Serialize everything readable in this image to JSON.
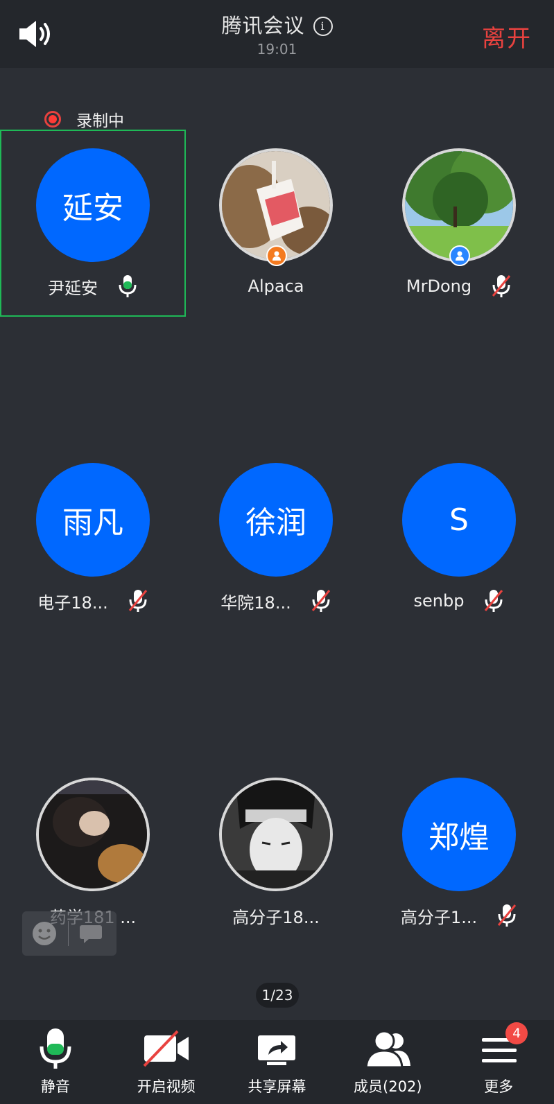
{
  "header": {
    "title": "腾讯会议",
    "time": "19:01",
    "leave_label": "离开"
  },
  "recording": {
    "label": "录制中"
  },
  "participants": [
    {
      "avatar_text": "延安",
      "name": "尹延安",
      "mic": "active"
    },
    {
      "avatar_text": "",
      "name": "Alpaca",
      "mic": "none",
      "badge": "host"
    },
    {
      "avatar_text": "",
      "name": "MrDong",
      "mic": "muted",
      "badge": "cohost"
    },
    {
      "avatar_text": "雨凡",
      "name": "电子18...",
      "mic": "muted"
    },
    {
      "avatar_text": "徐润",
      "name": "华院18...",
      "mic": "muted"
    },
    {
      "avatar_text": "S",
      "name": "senbp",
      "mic": "muted"
    },
    {
      "avatar_text": "",
      "name": "药学181 ...",
      "mic": "none"
    },
    {
      "avatar_text": "",
      "name": "高分子18...",
      "mic": "none"
    },
    {
      "avatar_text": "郑煌",
      "name": "高分子1...",
      "mic": "muted"
    }
  ],
  "pager": {
    "label": "1/23"
  },
  "toolbar": {
    "mute_label": "静音",
    "video_label": "开启视频",
    "share_label": "共享屏幕",
    "members_label": "成员(202)",
    "more_label": "更多",
    "more_badge": "4"
  },
  "colors": {
    "accent": "#0068ff",
    "leave": "#e8423f",
    "speaking": "#1fb957",
    "muted_slash": "#e8423f",
    "background": "#2c2f35"
  }
}
